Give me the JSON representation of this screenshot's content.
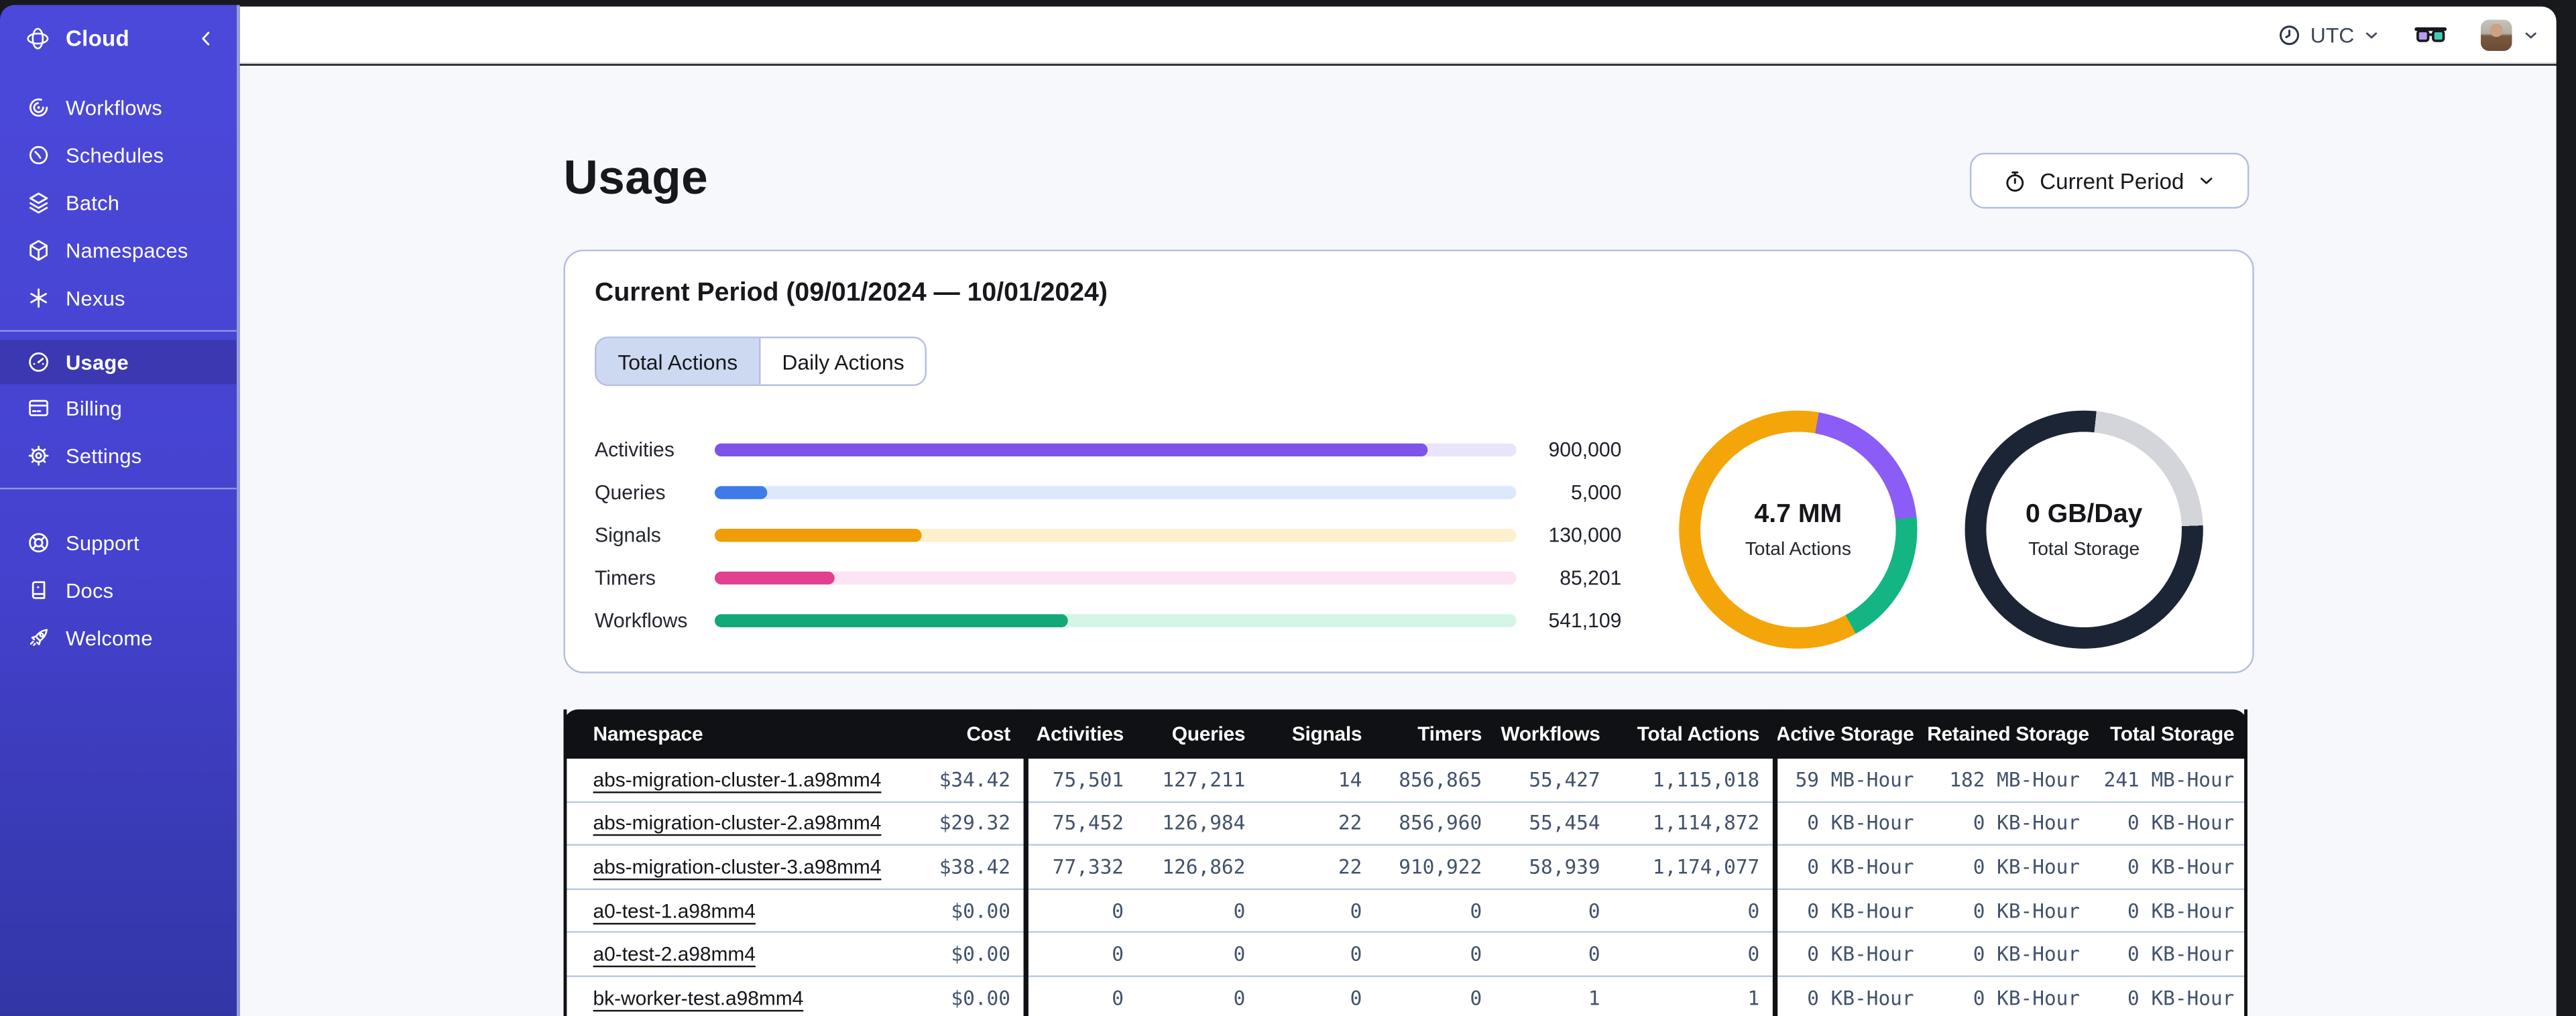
{
  "topbar": {
    "timezone": {
      "icon": "clock-icon",
      "label": "UTC"
    },
    "glasses_icon": "glasses-icon",
    "account": {
      "icon": "avatar"
    }
  },
  "sidebar": {
    "brand": {
      "icon": "temporal-orbit-icon",
      "label": "Cloud"
    },
    "nav_main": [
      {
        "icon": "workflows-icon",
        "label": "Workflows"
      },
      {
        "icon": "schedules-icon",
        "label": "Schedules"
      },
      {
        "icon": "batch-icon",
        "label": "Batch"
      },
      {
        "icon": "namespaces-icon",
        "label": "Namespaces"
      },
      {
        "icon": "nexus-icon",
        "label": "Nexus"
      }
    ],
    "nav_account": [
      {
        "icon": "usage-gauge-icon",
        "label": "Usage",
        "active": true
      },
      {
        "icon": "billing-icon",
        "label": "Billing"
      },
      {
        "icon": "settings-icon",
        "label": "Settings"
      }
    ],
    "nav_footer": [
      {
        "icon": "support-icon",
        "label": "Support"
      },
      {
        "icon": "docs-icon",
        "label": "Docs"
      },
      {
        "icon": "welcome-icon",
        "label": "Welcome"
      }
    ]
  },
  "page": {
    "title": "Usage",
    "period_button": {
      "icon": "stopwatch-icon",
      "label": "Current Period"
    }
  },
  "card": {
    "title": "Current Period (09/01/2024 — 10/01/2024)",
    "tabs": [
      {
        "label": "Total Actions",
        "active": true
      },
      {
        "label": "Daily Actions",
        "active": false
      }
    ]
  },
  "chart_data": [
    {
      "type": "bar",
      "orientation": "horizontal",
      "categories": [
        "Activities",
        "Queries",
        "Signals",
        "Timers",
        "Workflows"
      ],
      "values": [
        900000,
        5000,
        130000,
        85201,
        541109
      ],
      "display_values": [
        "900,000",
        "5,000",
        "130,000",
        "85,201",
        "541,109"
      ],
      "fill_fractions": [
        0.89,
        0.066,
        0.258,
        0.15,
        0.44
      ],
      "colors": [
        "#7d53e8",
        "#3e7be8",
        "#f09d08",
        "#e2418f",
        "#13a877"
      ],
      "track_colors": [
        "#eae4fa",
        "#dce8fb",
        "#fdf0cc",
        "#fce4f4",
        "#d5f6e7"
      ],
      "title": "",
      "xlabel": "",
      "ylabel": "",
      "grid": false
    },
    {
      "type": "pie",
      "style": "donut",
      "center_label": "4.7 MM",
      "center_sublabel": "Total Actions",
      "segments": [
        {
          "name": "orange",
          "color": "#f4a50a",
          "percent": 2.8,
          "end_deg": 10
        },
        {
          "name": "purple",
          "color": "#8b5cf6",
          "percent": 20.6,
          "end_deg": 84
        },
        {
          "name": "green",
          "color": "#13b583",
          "percent": 18.6,
          "end_deg": 151
        },
        {
          "name": "orange",
          "color": "#f4a50a",
          "percent": 58.0,
          "end_deg": 360
        }
      ]
    },
    {
      "type": "pie",
      "style": "donut",
      "center_label": "0 GB/Day",
      "center_sublabel": "Total Storage",
      "segments": [
        {
          "name": "dark",
          "color": "#1b2535",
          "percent": 1.7,
          "end_deg": 6
        },
        {
          "name": "light",
          "color": "#d4d5db",
          "percent": 22.8,
          "end_deg": 88
        },
        {
          "name": "dark",
          "color": "#1b2535",
          "percent": 75.5,
          "end_deg": 360
        }
      ]
    }
  ],
  "table": {
    "columns": [
      "Namespace",
      "Cost",
      "Activities",
      "Queries",
      "Signals",
      "Timers",
      "Workflows",
      "Total Actions",
      "Active Storage",
      "Retained Storage",
      "Total Storage"
    ],
    "rows": [
      {
        "namespace": "abs-migration-cluster-1.a98mm4",
        "cost": "$34.42",
        "activities": "75,501",
        "queries": "127,211",
        "signals": "14",
        "timers": "856,865",
        "workflows": "55,427",
        "total_actions": "1,115,018",
        "active_storage": "59 MB-Hour",
        "retained_storage": "182 MB-Hour",
        "total_storage": "241 MB-Hour"
      },
      {
        "namespace": "abs-migration-cluster-2.a98mm4",
        "cost": "$29.32",
        "activities": "75,452",
        "queries": "126,984",
        "signals": "22",
        "timers": "856,960",
        "workflows": "55,454",
        "total_actions": "1,114,872",
        "active_storage": "0 KB-Hour",
        "retained_storage": "0 KB-Hour",
        "total_storage": "0 KB-Hour"
      },
      {
        "namespace": "abs-migration-cluster-3.a98mm4",
        "cost": "$38.42",
        "activities": "77,332",
        "queries": "126,862",
        "signals": "22",
        "timers": "910,922",
        "workflows": "58,939",
        "total_actions": "1,174,077",
        "active_storage": "0 KB-Hour",
        "retained_storage": "0 KB-Hour",
        "total_storage": "0 KB-Hour"
      },
      {
        "namespace": "a0-test-1.a98mm4",
        "cost": "$0.00",
        "activities": "0",
        "queries": "0",
        "signals": "0",
        "timers": "0",
        "workflows": "0",
        "total_actions": "0",
        "active_storage": "0 KB-Hour",
        "retained_storage": "0 KB-Hour",
        "total_storage": "0 KB-Hour"
      },
      {
        "namespace": "a0-test-2.a98mm4",
        "cost": "$0.00",
        "activities": "0",
        "queries": "0",
        "signals": "0",
        "timers": "0",
        "workflows": "0",
        "total_actions": "0",
        "active_storage": "0 KB-Hour",
        "retained_storage": "0 KB-Hour",
        "total_storage": "0 KB-Hour"
      },
      {
        "namespace": "bk-worker-test.a98mm4",
        "cost": "$0.00",
        "activities": "0",
        "queries": "0",
        "signals": "0",
        "timers": "0",
        "workflows": "1",
        "total_actions": "1",
        "active_storage": "0 KB-Hour",
        "retained_storage": "0 KB-Hour",
        "total_storage": "0 KB-Hour"
      }
    ]
  }
}
